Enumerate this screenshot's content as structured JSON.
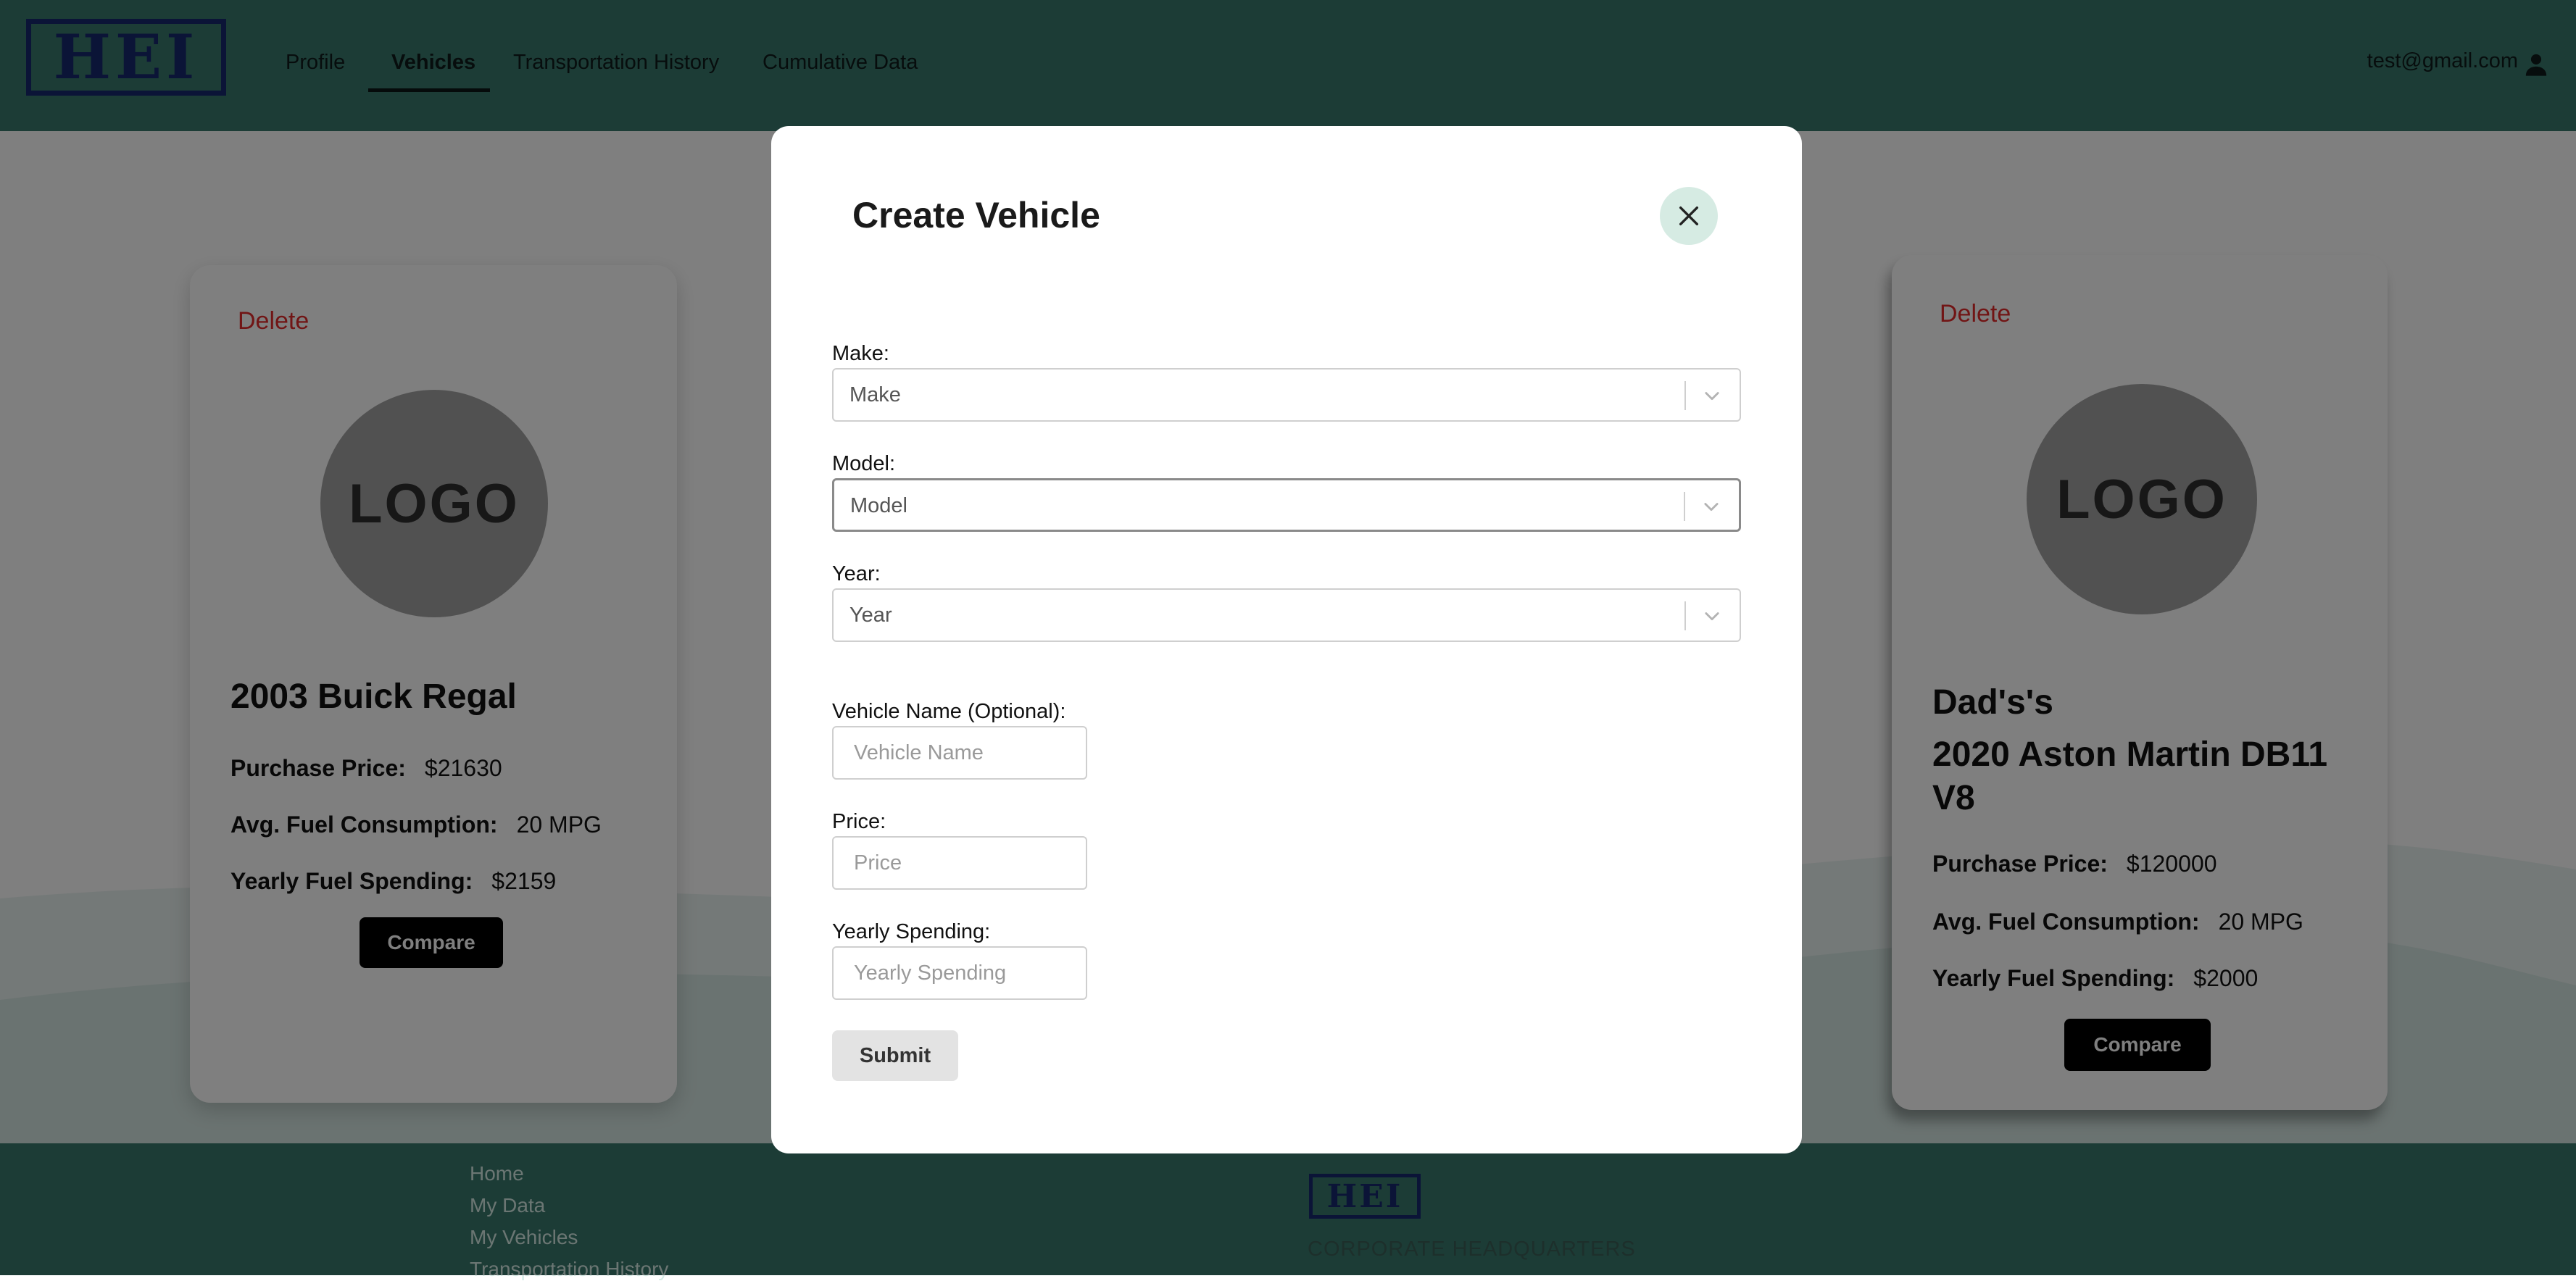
{
  "nav": {
    "logo_text": "HEI",
    "items": [
      {
        "label": "Profile"
      },
      {
        "label": "Vehicles"
      },
      {
        "label": "Transportation History"
      },
      {
        "label": "Cumulative Data"
      }
    ],
    "active_item": "Vehicles",
    "user_email": "test@gmail.com"
  },
  "cards": [
    {
      "delete_label": "Delete",
      "logo_text": "LOGO",
      "title": "2003 Buick Regal",
      "purchase_price_label": "Purchase Price:",
      "purchase_price": "$21630",
      "fuel_label": "Avg. Fuel Consumption:",
      "fuel": "20 MPG",
      "yearly_label": "Yearly Fuel Spending:",
      "yearly": "$2159",
      "compare_label": "Compare"
    },
    {
      "delete_label": "Delete",
      "logo_text": "LOGO",
      "nickname": "Dad's's",
      "title": "2020 Aston Martin DB11 V8",
      "purchase_price_label": "Purchase Price:",
      "purchase_price": "$120000",
      "fuel_label": "Avg. Fuel Consumption:",
      "fuel": "20 MPG",
      "yearly_label": "Yearly Fuel Spending:",
      "yearly": "$2000",
      "compare_label": "Compare"
    }
  ],
  "footer": {
    "links": [
      "Home",
      "My Data",
      "My Vehicles",
      "Transportation History"
    ],
    "logo_text": "HEI",
    "headquarters": "CORPORATE HEADQUARTERS"
  },
  "modal": {
    "title": "Create Vehicle",
    "make": {
      "label": "Make:",
      "placeholder": "Make"
    },
    "model": {
      "label": "Model:",
      "placeholder": "Model"
    },
    "year": {
      "label": "Year:",
      "placeholder": "Year"
    },
    "vehicle_name": {
      "label": "Vehicle Name (Optional):",
      "placeholder": "Vehicle Name"
    },
    "price": {
      "label": "Price:",
      "placeholder": "Price"
    },
    "yearly_spending": {
      "label": "Yearly Spending:",
      "placeholder": "Yearly Spending"
    },
    "submit_label": "Submit"
  },
  "colors": {
    "header_teal": "#39786d",
    "brand_navy": "#16286e",
    "delete_red": "#e32b2b",
    "close_button_bg": "#d6ebe3",
    "overlay": "rgba(0,0,0,0.5)"
  },
  "icons": {
    "close": "close-icon",
    "user": "user-icon",
    "chevron": "chevron-down-icon"
  }
}
